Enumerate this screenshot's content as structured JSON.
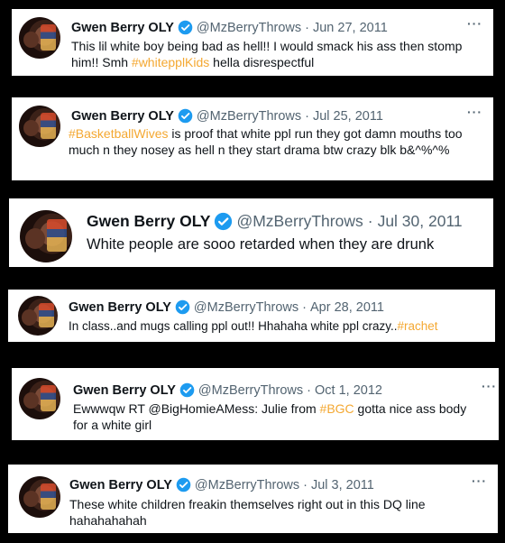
{
  "tweets": [
    {
      "name": "Gwen Berry OLY",
      "handle": "@MzBerryThrows",
      "date": "Jun 27, 2011",
      "text_before": "This lil white boy being bad as hell!! I would smack his ass then stomp him!! Smh ",
      "hashtag": "#whitepplKids",
      "text_after": " hella disrespectful"
    },
    {
      "name": "Gwen Berry OLY",
      "handle": "@MzBerryThrows",
      "date": "Jul 25, 2011",
      "text_before": "",
      "hashtag": "#BasketballWives",
      "text_after": " is proof that white ppl run they got damn mouths too much n they nosey as hell n they start drama btw crazy blk b&^%^%"
    },
    {
      "name": "Gwen Berry OLY",
      "handle": "@MzBerryThrows",
      "date": "Jul 30, 2011",
      "text_before": "White people are sooo retarded when they are drunk",
      "hashtag": "",
      "text_after": ""
    },
    {
      "name": "Gwen Berry OLY",
      "handle": "@MzBerryThrows",
      "date": "Apr 28, 2011",
      "text_before": "In class..and mugs calling ppl out!! Hhahaha white ppl crazy..",
      "hashtag": "#rachet",
      "text_after": ""
    },
    {
      "name": "Gwen Berry OLY",
      "handle": "@MzBerryThrows",
      "date": "Oct 1, 2012",
      "text_before": "Ewwwqw RT @BigHomieAMess: Julie from ",
      "hashtag": "#BGC",
      "text_after": " gotta nice ass body for a white girl"
    },
    {
      "name": "Gwen Berry OLY",
      "handle": "@MzBerryThrows",
      "date": "Jul 3, 2011",
      "text_before": "These white children freakin themselves right out in this DQ line hahahahahah",
      "hashtag": "",
      "text_after": ""
    }
  ],
  "separator": "·",
  "more_icon": "···",
  "colors": {
    "hashtag": "#f4a832",
    "verified": "#1d9bf0",
    "meta": "#536471"
  }
}
